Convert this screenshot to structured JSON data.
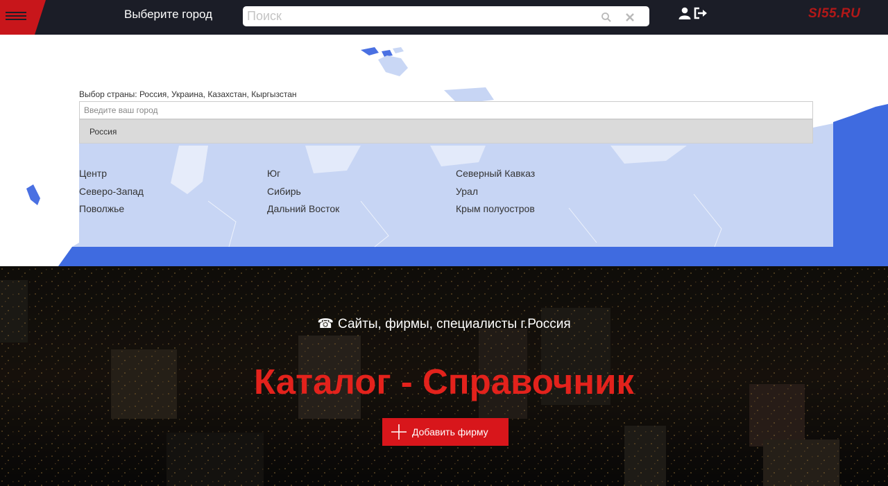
{
  "header": {
    "city_title": "Выберите город",
    "search_placeholder": "Поиск",
    "logo": "SI55.RU",
    "icons": [
      "menu-icon",
      "search-icon",
      "close-icon",
      "user-icon",
      "logout-icon"
    ]
  },
  "city_picker": {
    "country_label": "Выбор страны: Россия, Украина, Казахстан, Кыргызстан",
    "input_placeholder": "Введите ваш город",
    "suggestion": "Россия",
    "regions": [
      "Центр",
      "Юг",
      "Северный Кавказ",
      "Северо-Запад",
      "Сибирь",
      "Урал",
      "Поволжье",
      "Дальний Восток",
      "Крым полуостров"
    ]
  },
  "hero": {
    "tagline": "Сайты, фирмы, специалисты г.Россия",
    "headline": "Каталог - Справочник",
    "add_button": "Добавить фирму"
  },
  "colors": {
    "topbar": "#1b1d27",
    "brand_red": "#d8161b",
    "headline_red": "#e3221c",
    "map_blue": "#3f6be0",
    "map_light": "#c7d5f4"
  }
}
